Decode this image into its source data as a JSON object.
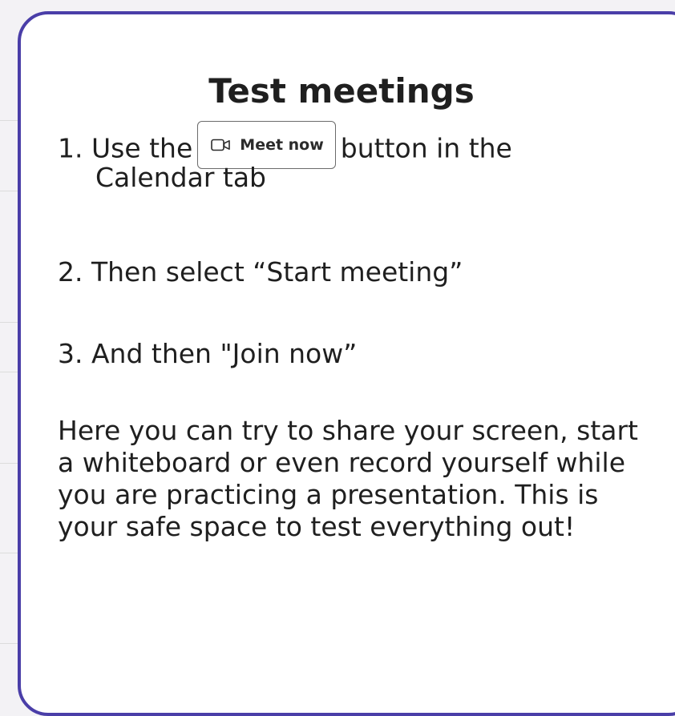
{
  "card": {
    "title": "Test meetings",
    "step1_prefix": "1. Use the",
    "meet_now_button": {
      "label": "Meet now",
      "icon": "video-camera-icon"
    },
    "step1_suffix": "button in the",
    "step1_line2": "Calendar tab",
    "step2": "2. Then select “Start meeting”",
    "step3": "3. And then \"Join now”",
    "paragraph": "Here you can try to share your screen, start a whiteboard or even record yourself while you are practicing a presentation. This is your safe space to test everything out!"
  },
  "colors": {
    "card_border": "#4a3ea8",
    "background": "#f3f2f5",
    "text": "#1f1f1f"
  }
}
